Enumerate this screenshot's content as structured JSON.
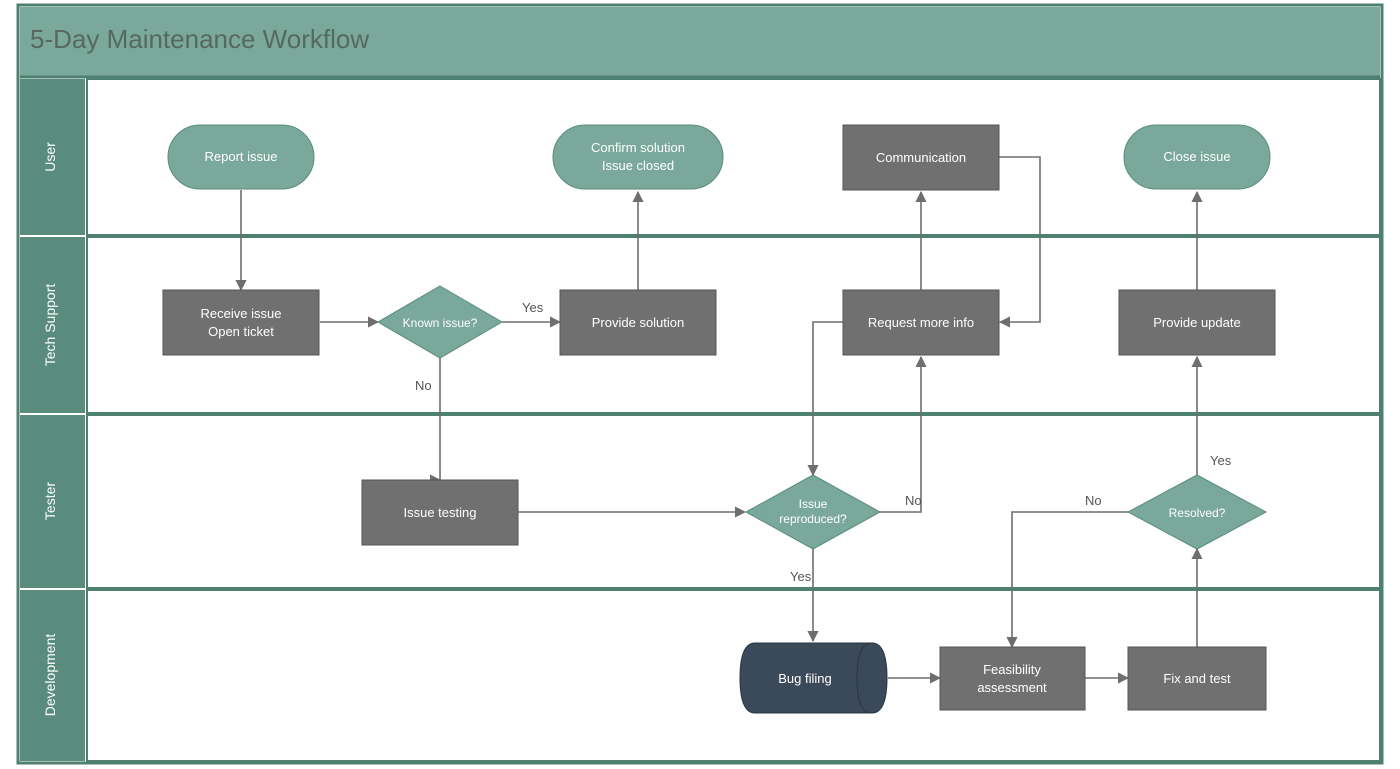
{
  "title": "5-Day Maintenance Workflow",
  "lanes": {
    "user": {
      "label": "User"
    },
    "tech_support": {
      "label": "Tech Support"
    },
    "tester": {
      "label": "Tester"
    },
    "development": {
      "label": "Development"
    }
  },
  "nodes": {
    "report_issue": {
      "label": "Report issue"
    },
    "confirm_solution_l1": "Confirm solution",
    "confirm_solution_l2": "Issue closed",
    "communication": {
      "label": "Communication"
    },
    "close_issue": {
      "label": "Close issue"
    },
    "receive_issue_l1": "Receive issue",
    "receive_issue_l2": "Open ticket",
    "known_issue": {
      "label": "Known issue?"
    },
    "provide_solution": {
      "label": "Provide solution"
    },
    "request_more_info": {
      "label": "Request more info"
    },
    "provide_update": {
      "label": "Provide update"
    },
    "issue_testing": {
      "label": "Issue testing"
    },
    "issue_reproduced_l1": "Issue",
    "issue_reproduced_l2": "reproduced?",
    "resolved": {
      "label": "Resolved?"
    },
    "bug_filing": {
      "label": "Bug filing"
    },
    "feasibility_l1": "Feasibility",
    "feasibility_l2": "assessment",
    "fix_and_test": {
      "label": "Fix and test"
    }
  },
  "edges": {
    "yes1": "Yes",
    "no1": "No",
    "yes2": "Yes",
    "no2": "No",
    "yes3": "Yes",
    "no3": "No"
  },
  "colors": {
    "teal_header": "#7aa99c",
    "teal_lane": "#5a8c7e",
    "teal_node": "#7aa99c",
    "gray_node": "#707070",
    "dark_node": "#3a4a5a",
    "lane_border": "#4d8070",
    "connector": "#6e6e6e"
  }
}
